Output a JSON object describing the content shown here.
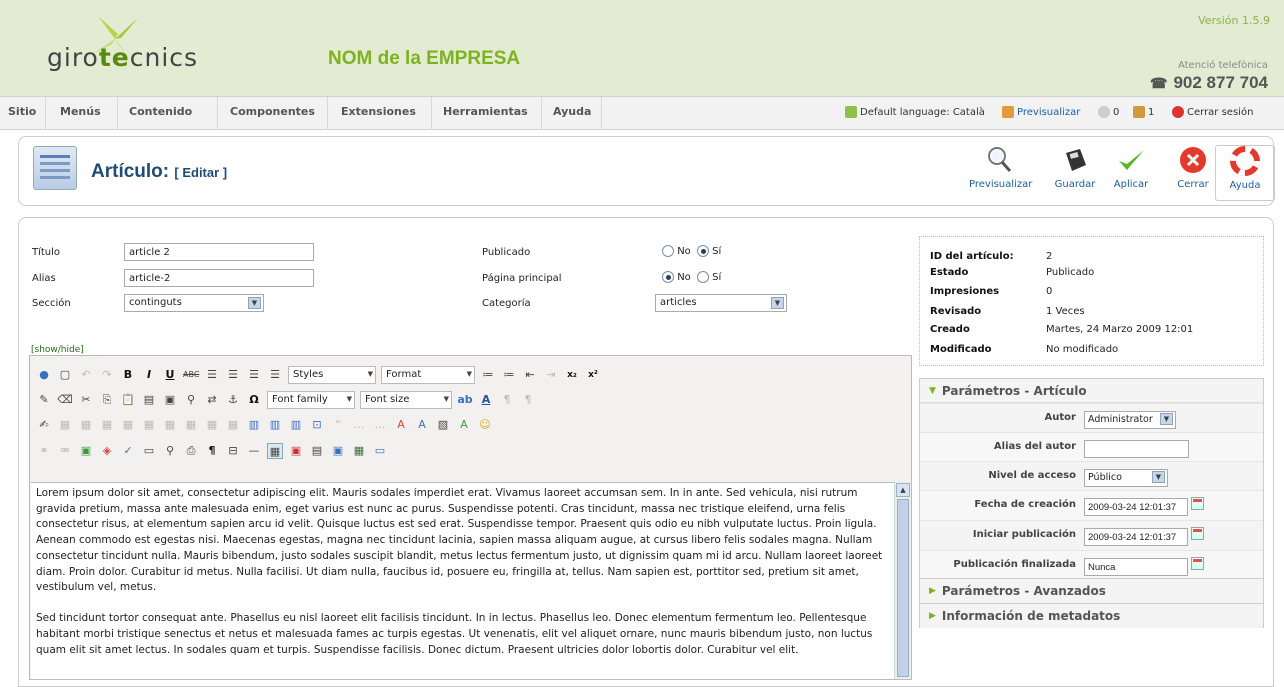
{
  "header": {
    "logo_text_a": "giro",
    "logo_text_b": "te",
    "logo_text_c": "cnics",
    "company": "NOM de la EMPRESA",
    "version": "Versión 1.5.9",
    "phone_label": "Atenció telefònica",
    "phone": "902 877 704"
  },
  "menu": {
    "items": [
      "Sitio",
      "Menús",
      "Contenido",
      "Componentes",
      "Extensiones",
      "Herramientas",
      "Ayuda"
    ],
    "default_language": "Default language: Català",
    "preview": "Previsualizar",
    "messages_count": "0",
    "users_count": "1",
    "logout": "Cerrar sesión"
  },
  "toolbar": {
    "title": "Artículo:",
    "subtitle": "[ Editar ]",
    "buttons": [
      {
        "label": "Previsualizar",
        "icon": "magnifier-icon"
      },
      {
        "label": "Guardar",
        "icon": "save-disk-icon"
      },
      {
        "label": "Aplicar",
        "icon": "check-icon"
      },
      {
        "label": "Cerrar",
        "icon": "close-icon"
      },
      {
        "label": "Ayuda",
        "icon": "help-lifebuoy-icon"
      }
    ]
  },
  "form": {
    "title_label": "Título",
    "title_value": "article 2",
    "alias_label": "Alias",
    "alias_value": "article-2",
    "section_label": "Sección",
    "section_value": "continguts",
    "published_label": "Publicado",
    "frontpage_label": "Página principal",
    "category_label": "Categoría",
    "category_value": "articles",
    "no_label": "No",
    "yes_label": "Sí",
    "published": "Sí",
    "frontpage": "No"
  },
  "editor": {
    "showhide": "[show/hide]",
    "styles": "Styles",
    "format": "Format",
    "font_family": "Font family",
    "font_size": "Font size",
    "paragraph_1": "Lorem ipsum dolor sit amet, consectetur adipiscing elit. Mauris sodales imperdiet erat. Vivamus laoreet accumsan sem. In in ante. Sed vehicula, nisi rutrum gravida pretium, massa ante malesuada enim, eget varius est nunc ac purus. Suspendisse potenti. Cras tincidunt, massa nec tristique eleifend, urna felis consectetur risus, at elementum sapien arcu id velit. Quisque luctus est sed erat. Suspendisse tempor. Praesent quis odio eu nibh vulputate luctus. Proin ligula. Aenean commodo est egestas nisi. Maecenas egestas, magna nec tincidunt lacinia, sapien massa aliquam augue, at cursus libero felis sodales magna. Nullam consectetur tincidunt nulla. Mauris bibendum, justo sodales suscipit blandit, metus lectus fermentum justo, ut dignissim quam mi id arcu. Nullam laoreet laoreet diam. Proin dolor. Curabitur id metus. Nulla facilisi. Ut diam nulla, faucibus id, posuere eu, fringilla at, tellus. Nam sapien est, porttitor sed, pretium sit amet, vestibulum vel, metus.",
    "paragraph_2": "Sed tincidunt tortor consequat ante. Phasellus eu nisl laoreet elit facilisis tincidunt. In in lectus. Phasellus leo. Donec elementum fermentum leo. Pellentesque habitant morbi tristique senectus et netus et malesuada fames ac turpis egestas. Ut venenatis, elit vel aliquet ornare, nunc mauris bibendum justo, non luctus quam elit sit amet lectus. In sodales quam et turpis. Suspendisse facilisis. Donec dictum. Praesent ultricies dolor lobortis dolor. Curabitur vel elit."
  },
  "info": {
    "rows": [
      {
        "k": "ID del artículo:",
        "v": "2"
      },
      {
        "k": "Estado",
        "v": "Publicado"
      },
      {
        "k": "Impresiones",
        "v": "0"
      },
      {
        "k": "Revisado",
        "v": "1 Veces"
      },
      {
        "k": "Creado",
        "v": "Martes, 24 Marzo 2009 12:01"
      },
      {
        "k": "Modificado",
        "v": "No modificado"
      }
    ]
  },
  "params": {
    "title": "Parámetros - Artículo",
    "author_label": "Autor",
    "author_value": "Administrator",
    "author_alias_label": "Alias del autor",
    "author_alias_value": "",
    "access_label": "Nivel de acceso",
    "access_value": "Público",
    "created_label": "Fecha de creación",
    "created_value": "2009-03-24 12:01:37",
    "start_label": "Iniciar publicación",
    "start_value": "2009-03-24 12:01:37",
    "end_label": "Publicación finalizada",
    "end_value": "Nunca",
    "advanced_title": "Parámetros - Avanzados",
    "metadata_title": "Información de metadatos"
  }
}
